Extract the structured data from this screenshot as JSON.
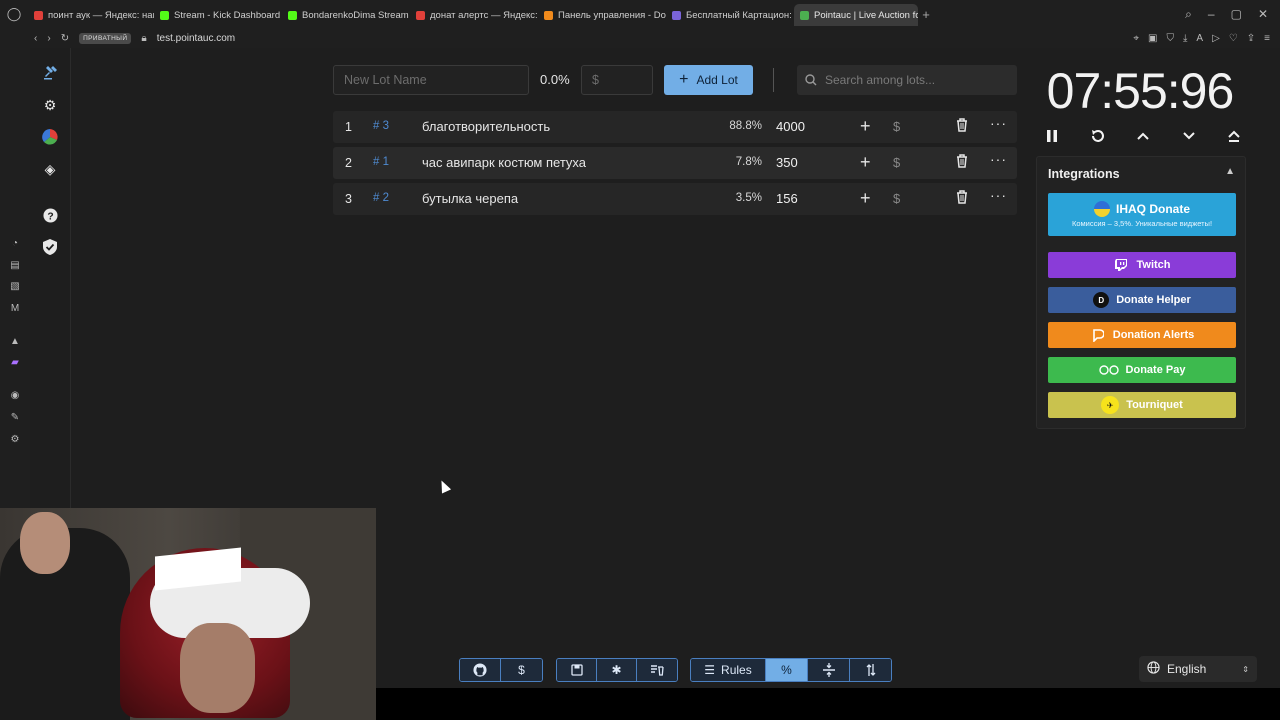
{
  "browser": {
    "tabs": [
      {
        "label": "поинт аук — Яндекс: наш",
        "color": "#e0403a"
      },
      {
        "label": "Stream - Kick Dashboard",
        "color": "#53fc18"
      },
      {
        "label": "BondarenkoDima Stream",
        "color": "#53fc18"
      },
      {
        "label": "донат алертс — Яндекс:",
        "color": "#e0403a"
      },
      {
        "label": "Панель управления - Do",
        "color": "#f08a1c"
      },
      {
        "label": "Бесплатный Картацион: /",
        "color": "#7a64d8"
      },
      {
        "label": "Pointauc | Live Auction for",
        "color": "#4caf50",
        "active": true
      }
    ],
    "new_tab": "+",
    "private_badge": "ПРИВАТНЫЙ",
    "url": "test.pointauc.com"
  },
  "toolbar": {
    "lot_name_placeholder": "New Lot Name",
    "percent": "0.0%",
    "amount_placeholder": "$",
    "add_lot_label": "Add Lot",
    "search_placeholder": "Search among lots..."
  },
  "lots": [
    {
      "index": "1",
      "tag": "# 3",
      "name": "благотворительность",
      "percent": "88.8%",
      "amount": "4000"
    },
    {
      "index": "2",
      "tag": "# 1",
      "name": "час авипарк костюм петуха",
      "percent": "7.8%",
      "amount": "350"
    },
    {
      "index": "3",
      "tag": "# 2",
      "name": "бутылка черепа",
      "percent": "3.5%",
      "amount": "156"
    }
  ],
  "lot_actions": {
    "plus": "+",
    "dollar": "$",
    "more": "···"
  },
  "timer": {
    "value": "07:55:96"
  },
  "integrations": {
    "title": "Integrations",
    "ihaq": {
      "label": "IHAQ Donate",
      "sub": "Комиссия – 3,5%. Уникальные виджеты!"
    },
    "twitch": "Twitch",
    "donate_helper": "Donate Helper",
    "donation_alerts": "Donation Alerts",
    "donate_pay": "Donate Pay",
    "tourniquet": "Tourniquet"
  },
  "bottom": {
    "rules": "Rules",
    "percent": "%"
  },
  "language": {
    "selected": "English"
  }
}
